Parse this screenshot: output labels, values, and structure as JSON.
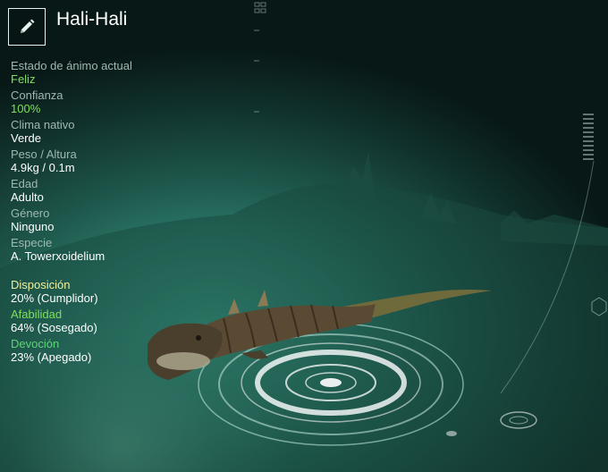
{
  "header": {
    "pet_name": "Hali-Hali",
    "edit_icon": "pencil-icon"
  },
  "stats": [
    {
      "label": "Estado de ánimo actual",
      "value": "Feliz"
    },
    {
      "label": "Confianza",
      "value": "100%"
    },
    {
      "label": "Clima nativo",
      "value": "Verde"
    },
    {
      "label": "Peso / Altura",
      "value": "4.9kg / 0.1m"
    },
    {
      "label": "Edad",
      "value": "Adulto"
    },
    {
      "label": "Género",
      "value": "Ninguno"
    },
    {
      "label": "Especie",
      "value": "A. Towerxoidelium"
    }
  ],
  "traits": [
    {
      "label": "Disposición",
      "value": "20% (Cumplidor)"
    },
    {
      "label": "Afabilidad",
      "value": "64% (Sosegado)"
    },
    {
      "label": "Devoción",
      "value": "23% (Apegado)"
    }
  ],
  "colors": {
    "highlight_green": "#7ee05a",
    "disposition_yellow": "#f3f09a",
    "label_grey": "#9fb8b1"
  }
}
